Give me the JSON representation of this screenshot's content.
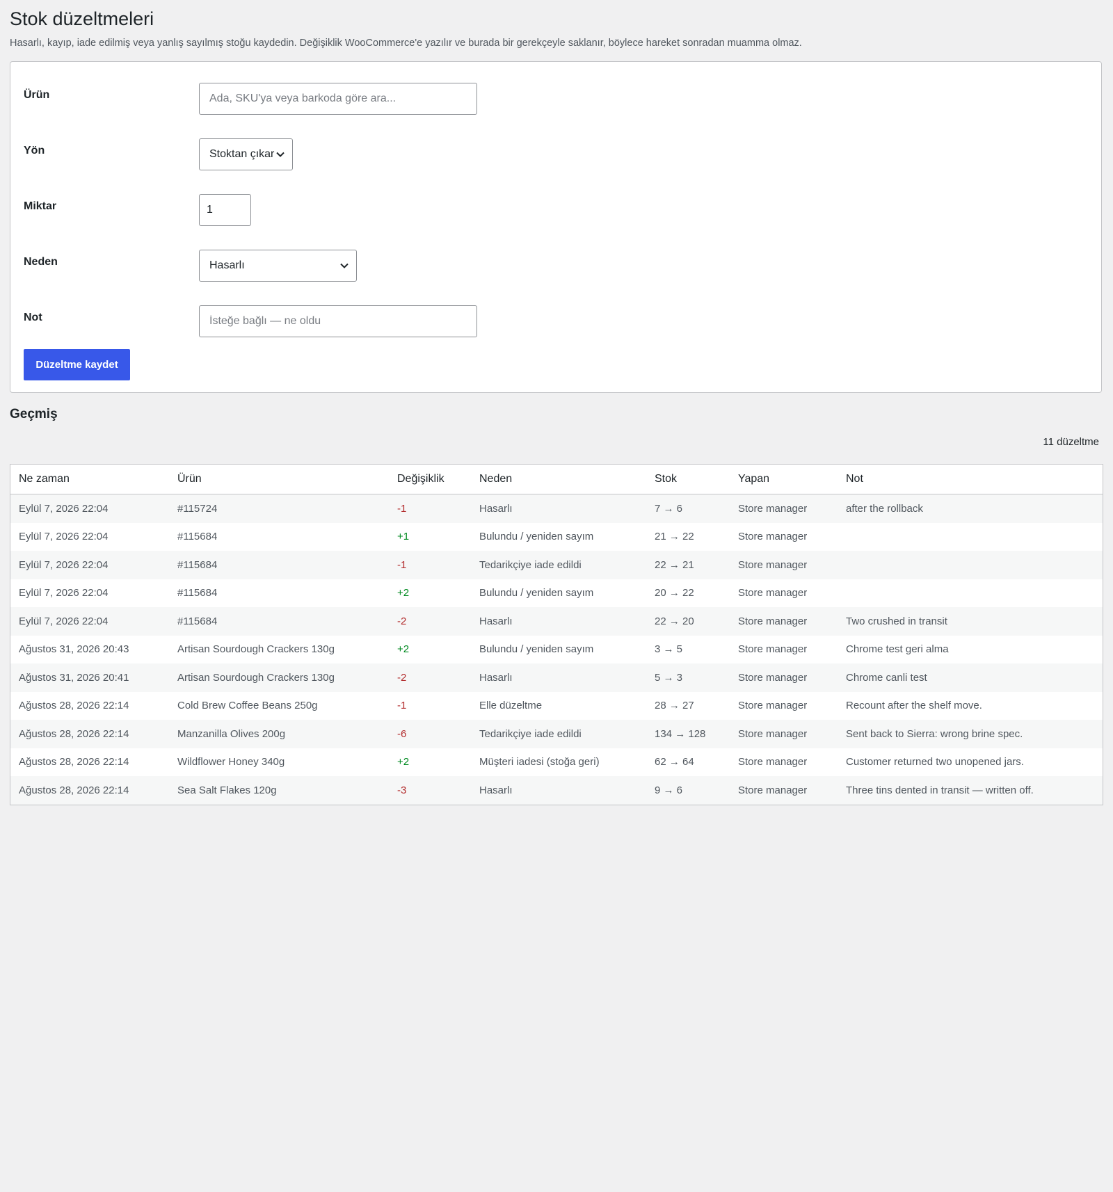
{
  "header": {
    "title": "Stok düzeltmeleri",
    "description": "Hasarlı, kayıp, iade edilmiş veya yanlış sayılmış stoğu kaydedin. Değişiklik WooCommerce'e yazılır ve burada bir gerekçeyle saklanır, böylece hareket sonradan muamma olmaz."
  },
  "form": {
    "product_label": "Ürün",
    "product_placeholder": "Ada, SKU'ya veya barkoda göre ara...",
    "direction_label": "Yön",
    "direction_value": "Stoktan çıkar",
    "quantity_label": "Miktar",
    "quantity_value": "1",
    "reason_label": "Neden",
    "reason_value": "Hasarlı",
    "note_label": "Not",
    "note_placeholder": "İsteğe bağlı — ne oldu",
    "submit_label": "Düzeltme kaydet"
  },
  "history": {
    "title": "Geçmiş",
    "count": "11 düzeltme",
    "columns": [
      "Ne zaman",
      "Ürün",
      "Değişiklik",
      "Neden",
      "Stok",
      "Yapan",
      "Not"
    ],
    "rows": [
      {
        "when": "Eylül 7, 2026 22:04",
        "product": "#115724",
        "change": "-1",
        "reason": "Hasarlı",
        "stock": "7 → 6",
        "by": "Store manager",
        "note": "after the rollback"
      },
      {
        "when": "Eylül 7, 2026 22:04",
        "product": "#115684",
        "change": "+1",
        "reason": "Bulundu / yeniden sayım",
        "stock": "21 → 22",
        "by": "Store manager",
        "note": ""
      },
      {
        "when": "Eylül 7, 2026 22:04",
        "product": "#115684",
        "change": "-1",
        "reason": "Tedarikçiye iade edildi",
        "stock": "22 → 21",
        "by": "Store manager",
        "note": ""
      },
      {
        "when": "Eylül 7, 2026 22:04",
        "product": "#115684",
        "change": "+2",
        "reason": "Bulundu / yeniden sayım",
        "stock": "20 → 22",
        "by": "Store manager",
        "note": ""
      },
      {
        "when": "Eylül 7, 2026 22:04",
        "product": "#115684",
        "change": "-2",
        "reason": "Hasarlı",
        "stock": "22 → 20",
        "by": "Store manager",
        "note": "Two crushed in transit"
      },
      {
        "when": "Ağustos 31, 2026 20:43",
        "product": "Artisan Sourdough Crackers 130g",
        "change": "+2",
        "reason": "Bulundu / yeniden sayım",
        "stock": "3 → 5",
        "by": "Store manager",
        "note": "Chrome test geri alma"
      },
      {
        "when": "Ağustos 31, 2026 20:41",
        "product": "Artisan Sourdough Crackers 130g",
        "change": "-2",
        "reason": "Hasarlı",
        "stock": "5 → 3",
        "by": "Store manager",
        "note": "Chrome canli test"
      },
      {
        "when": "Ağustos 28, 2026 22:14",
        "product": "Cold Brew Coffee Beans 250g",
        "change": "-1",
        "reason": "Elle düzeltme",
        "stock": "28 → 27",
        "by": "Store manager",
        "note": "Recount after the shelf move."
      },
      {
        "when": "Ağustos 28, 2026 22:14",
        "product": "Manzanilla Olives 200g",
        "change": "-6",
        "reason": "Tedarikçiye iade edildi",
        "stock": "134 → 128",
        "by": "Store manager",
        "note": "Sent back to Sierra: wrong brine spec."
      },
      {
        "when": "Ağustos 28, 2026 22:14",
        "product": "Wildflower Honey 340g",
        "change": "+2",
        "reason": "Müşteri iadesi (stoğa geri)",
        "stock": "62 → 64",
        "by": "Store manager",
        "note": "Customer returned two unopened jars."
      },
      {
        "when": "Ağustos 28, 2026 22:14",
        "product": "Sea Salt Flakes 120g",
        "change": "-3",
        "reason": "Hasarlı",
        "stock": "9 → 6",
        "by": "Store manager",
        "note": "Three tins dented in transit — written off."
      }
    ]
  },
  "colors": {
    "accent": "#3858e9",
    "negative": "#b32d2e",
    "positive": "#008a20"
  }
}
